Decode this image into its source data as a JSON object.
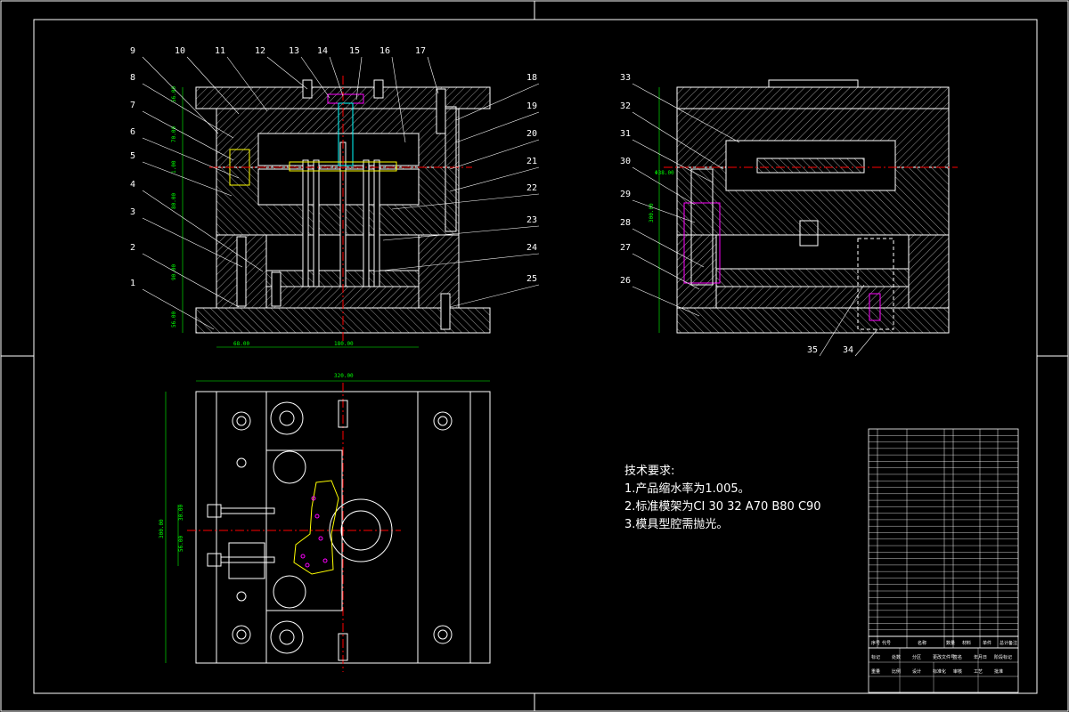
{
  "notes": {
    "title": "技术要求:",
    "items": [
      "1.产品缩水率为1.005。",
      "2.标准模架为CI 30 32 A70 B80 C90",
      "3.模具型腔需抛光。"
    ]
  },
  "callouts_left": [
    "9",
    "10",
    "11",
    "12",
    "13",
    "14",
    "15",
    "16",
    "17",
    "18",
    "19",
    "20",
    "21",
    "22",
    "23",
    "24",
    "25",
    "1",
    "2",
    "3",
    "4",
    "5",
    "6",
    "7",
    "8"
  ],
  "callouts_right": [
    "33",
    "32",
    "31",
    "30",
    "29",
    "28",
    "27",
    "26",
    "35",
    "34"
  ],
  "dimensions": {
    "left_h1": "56.00",
    "left_h2": "70.00",
    "left_h3": "1.00",
    "left_h4": "80.00",
    "left_h5": "90.00",
    "left_h6": "56.00",
    "left_w1": "68.00",
    "left_w2": "180.00",
    "plan_w": "320.00",
    "plan_h": "300.00",
    "plan_h2": "30.00",
    "plan_h3": "56.00",
    "right_h1": "300.00",
    "right_d": "Φ38.00"
  },
  "title_block": {
    "row_labels": [
      "序号",
      "代号",
      "名称",
      "数量",
      "材料",
      "单件",
      "总计",
      "备注"
    ],
    "footer": [
      "标记",
      "处数",
      "分区",
      "更改文件号",
      "签名",
      "年月日",
      "阶段标记",
      "重量",
      "比例",
      "设计",
      "标准化",
      "审核",
      "工艺",
      "批准"
    ]
  },
  "colors": {
    "background": "#000000",
    "lines": "#ffffff",
    "hatch": "#ffffff",
    "center": "#ff0000",
    "dimension": "#00ff00",
    "hidden": "#ffff00",
    "accent": "#ff00ff"
  }
}
